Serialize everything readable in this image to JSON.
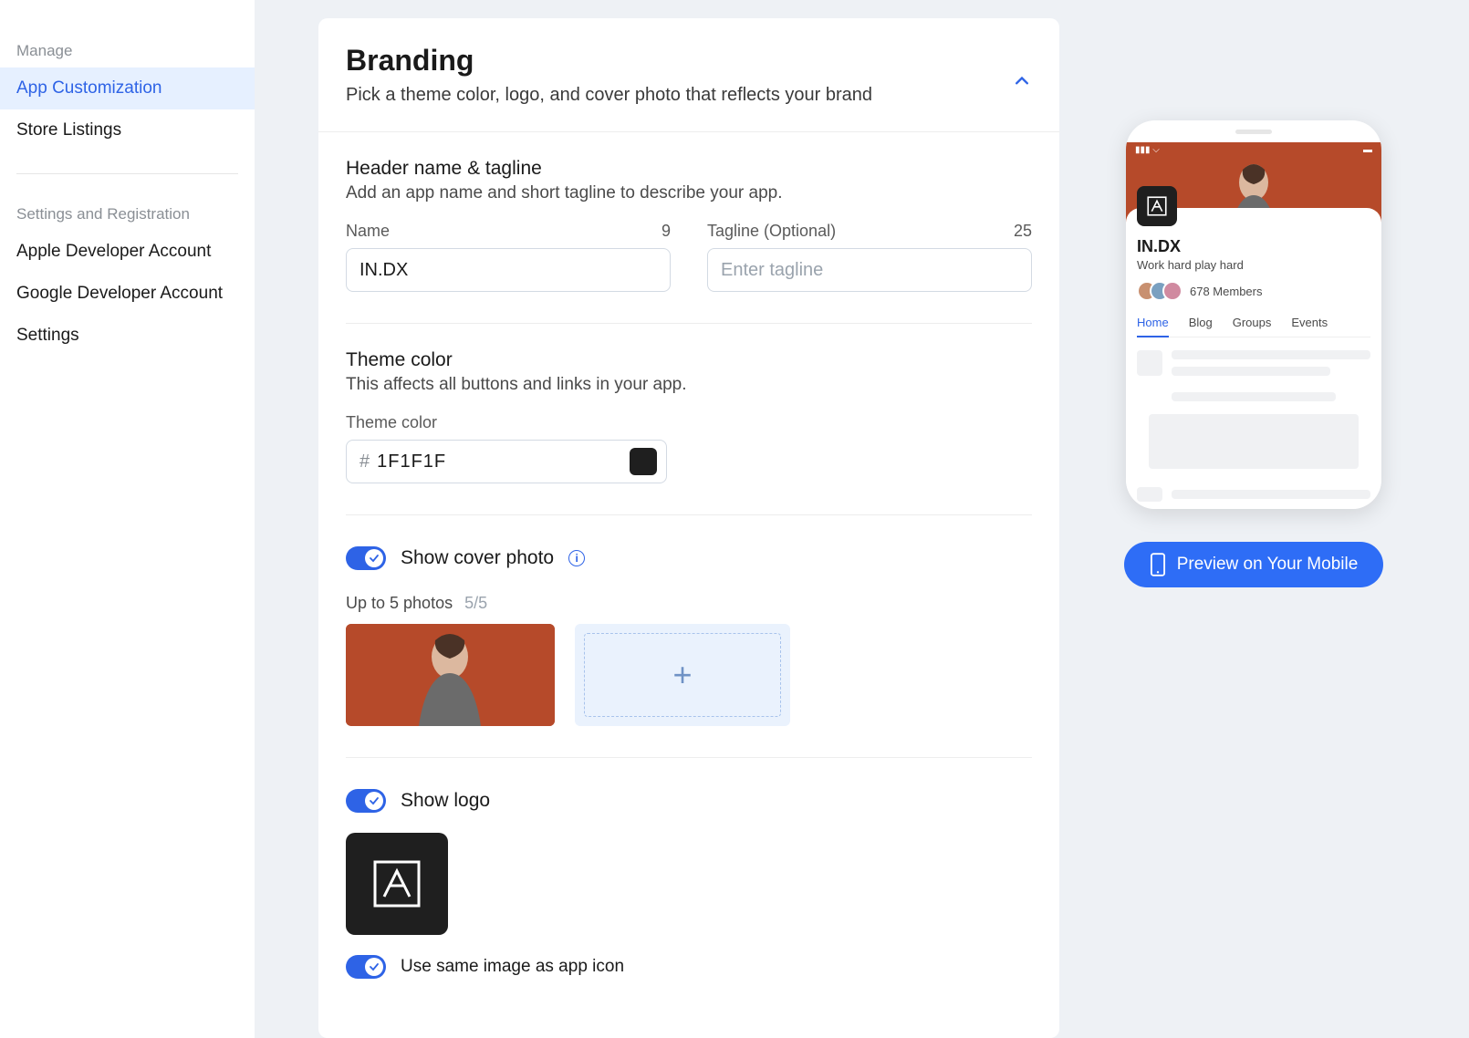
{
  "sidebar": {
    "manage_label": "Manage",
    "items_manage": [
      "App Customization",
      "Store Listings"
    ],
    "settings_label": "Settings and Registration",
    "items_settings": [
      "Apple Developer Account",
      "Google Developer Account",
      "Settings"
    ],
    "active": "App Customization"
  },
  "branding": {
    "title": "Branding",
    "subtitle": "Pick a theme color, logo, and cover photo that reflects your brand"
  },
  "header_section": {
    "title": "Header name & tagline",
    "desc": "Add an app name and short tagline to describe your app.",
    "name_label": "Name",
    "name_count": "9",
    "name_value": "IN.DX",
    "tagline_label": "Tagline (Optional)",
    "tagline_count": "25",
    "tagline_placeholder": "Enter tagline"
  },
  "theme_section": {
    "title": "Theme color",
    "desc": "This affects all buttons and links in your app.",
    "field_label": "Theme color",
    "hash": "#",
    "value": "1F1F1F",
    "swatch": "#1f1f1f"
  },
  "cover_section": {
    "toggle_label": "Show cover photo",
    "photos_label": "Up to 5 photos",
    "photos_count": "5/5"
  },
  "logo_section": {
    "toggle_label": "Show logo",
    "same_icon_label": "Use same image as app icon"
  },
  "preview": {
    "app_name": "IN.DX",
    "tagline": "Work hard play hard",
    "members": "678 Members",
    "tabs": [
      "Home",
      "Blog",
      "Groups",
      "Events"
    ],
    "button": "Preview on Your Mobile"
  },
  "colors": {
    "accent": "#2e63e6",
    "cover_bg": "#b64a2a"
  }
}
